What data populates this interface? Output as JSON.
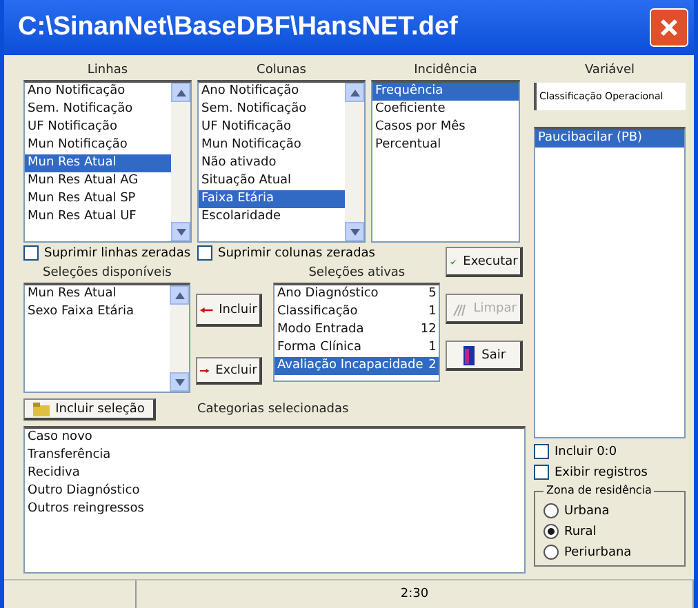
{
  "window": {
    "title": "C:\\SinanNet\\BaseDBF\\HansNET.def"
  },
  "row_list": {
    "label": "Linhas",
    "items": [
      {
        "text": "Ano Notificação",
        "selected": false
      },
      {
        "text": "Sem. Notificação",
        "selected": false
      },
      {
        "text": "UF Notificação",
        "selected": false
      },
      {
        "text": "Mun Notificação",
        "selected": false
      },
      {
        "text": "Mun Res Atual",
        "selected": true
      },
      {
        "text": "Mun Res Atual AG",
        "selected": false
      },
      {
        "text": "Mun Res Atual SP",
        "selected": false
      },
      {
        "text": "Mun Res Atual UF",
        "selected": false
      }
    ]
  },
  "row_check": {
    "label": "Suprimir linhas zeradas",
    "checked": false
  },
  "column_list": {
    "label": "Colunas",
    "items": [
      {
        "text": "Ano Notificação",
        "selected": false
      },
      {
        "text": "Sem. Notificação",
        "selected": false
      },
      {
        "text": "UF Notificação",
        "selected": false
      },
      {
        "text": "Mun Notificação",
        "selected": false
      },
      {
        "text": "Não ativado",
        "selected": false
      },
      {
        "text": "Situação Atual",
        "selected": false
      },
      {
        "text": "Faixa Etária",
        "selected": true
      },
      {
        "text": "Escolaridade",
        "selected": false
      }
    ]
  },
  "column_check": {
    "label": "Suprimir colunas zeradas",
    "checked": false
  },
  "measure_list": {
    "label": "Incidência",
    "items": [
      {
        "text": "Frequência",
        "selected": true
      },
      {
        "text": "Coeficiente",
        "selected": false
      },
      {
        "text": "Casos por Mês",
        "selected": false
      },
      {
        "text": "Percentual",
        "selected": false
      }
    ]
  },
  "available": {
    "label": "Seleções disponíveis",
    "items": [
      {
        "text": "Mun Res Atual",
        "selected": false
      },
      {
        "text": "Sexo Faixa Etária",
        "selected": false
      }
    ]
  },
  "include_button": {
    "label": "Incluir"
  },
  "exclude_button": {
    "label": "Excluir"
  },
  "active": {
    "label": "Seleções ativas",
    "items": [
      {
        "text": "Ano Diagnóstico",
        "count": "5",
        "selected": false
      },
      {
        "text": "Classificação",
        "count": "1",
        "selected": false
      },
      {
        "text": "Modo Entrada",
        "count": "12",
        "selected": false
      },
      {
        "text": "Forma Clínica",
        "count": "1",
        "selected": false
      },
      {
        "text": "Avaliação Incapacidade",
        "count": "2",
        "selected": true
      }
    ]
  },
  "actions": [
    {
      "label": "Executar",
      "kind": "execute",
      "disabled": false
    },
    {
      "label": "Limpar",
      "kind": "clear",
      "disabled": true
    },
    {
      "label": "Sair",
      "kind": "exit",
      "disabled": false
    }
  ],
  "select_button": {
    "label": "Incluir seleção"
  },
  "categories": {
    "label": "Categorias selecionadas",
    "items": [
      "Caso novo",
      "Transferência",
      "Recidiva",
      "Outro Diagnóstico",
      "Outros reingressos"
    ]
  },
  "variable": {
    "label": "Variável",
    "value": "Classificação Operacional",
    "items": [
      {
        "text": "Paucibacilar (PB)",
        "selected": true
      }
    ]
  },
  "options": [
    {
      "label": "Incluir 0:0",
      "checked": false
    },
    {
      "label": "Exibir registros",
      "checked": false
    }
  ],
  "zone_group": {
    "label": "Zona de residência",
    "options": [
      {
        "label": "Urbana",
        "selected": false
      },
      {
        "label": "Rural",
        "selected": true
      },
      {
        "label": "Periurbana",
        "selected": false
      }
    ]
  },
  "status_bar": {
    "time": "2:30"
  }
}
